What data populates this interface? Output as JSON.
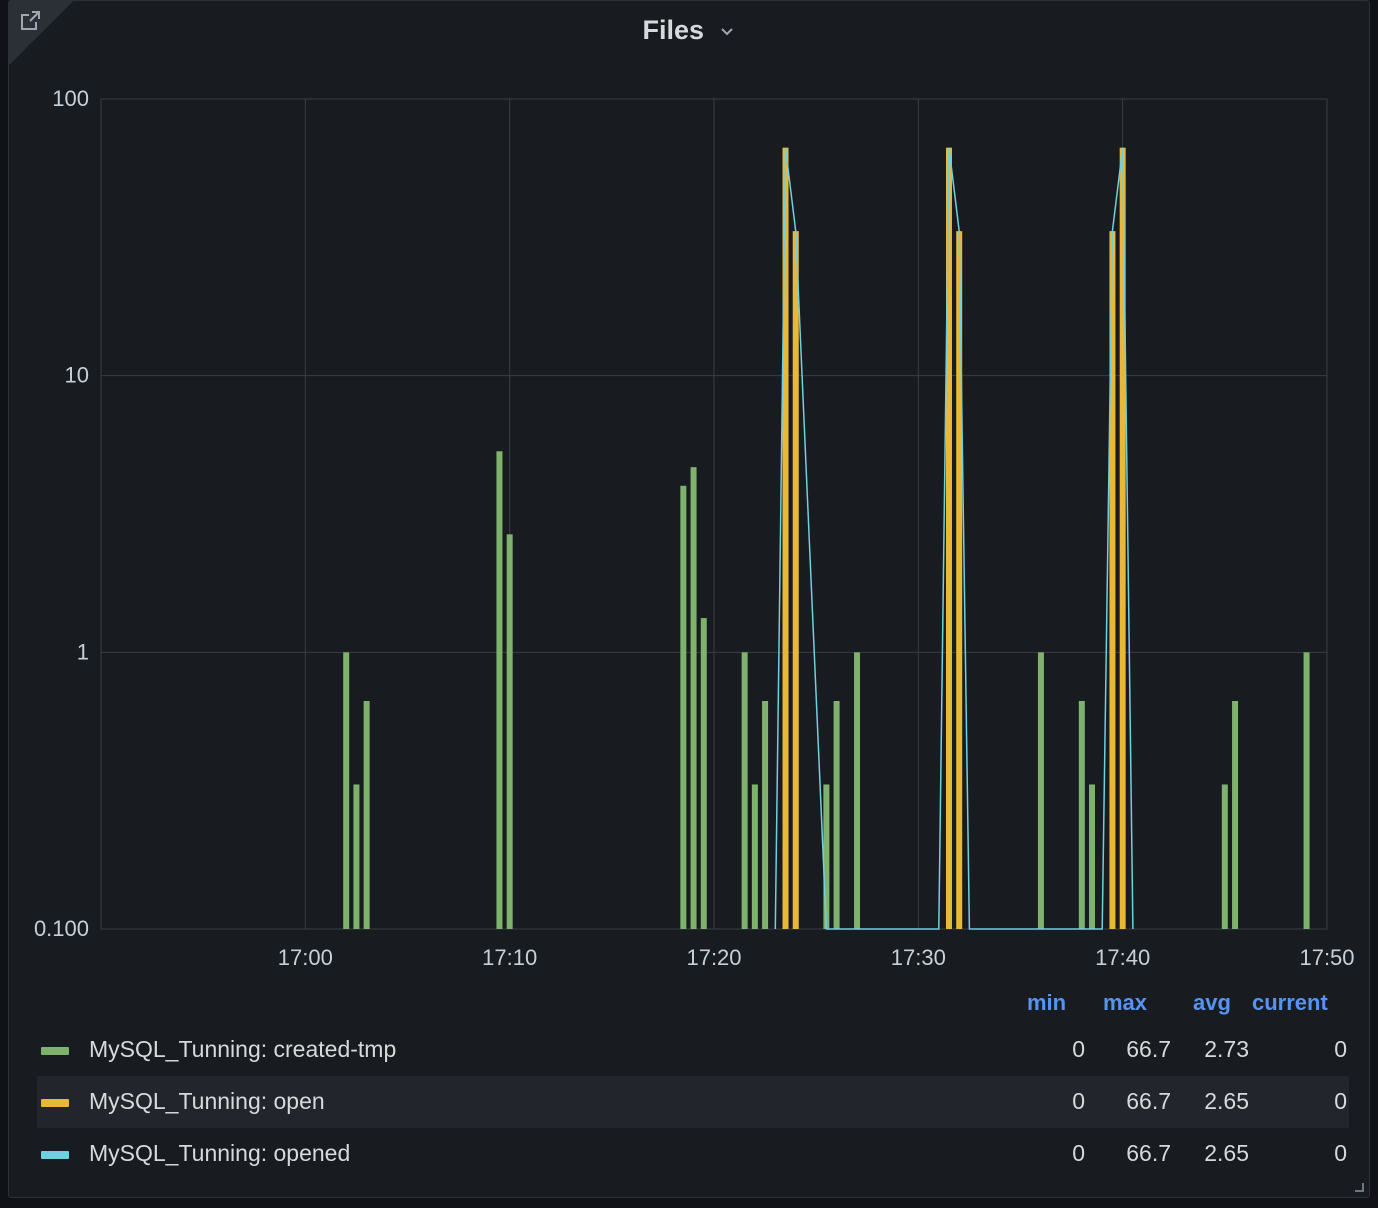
{
  "panel": {
    "title": "Files"
  },
  "icons": {
    "share": "external-link-icon",
    "title_menu": "chevron-down-icon",
    "resize": "resize-handle-icon"
  },
  "colors": {
    "background": "#181b1f",
    "grid": "#3a3d44",
    "created_tmp": "#7eb26d",
    "open": "#eab839",
    "opened": "#6ed0e0",
    "legend_header": "#5794f2"
  },
  "legend": {
    "headers": {
      "min": "min",
      "max": "max",
      "avg": "avg",
      "current": "current"
    },
    "rows": [
      {
        "name": "MySQL_Tunning: created-tmp",
        "min": "0",
        "max": "66.7",
        "avg": "2.73",
        "current": "0",
        "color": "#7eb26d"
      },
      {
        "name": "MySQL_Tunning: open",
        "min": "0",
        "max": "66.7",
        "avg": "2.65",
        "current": "0",
        "color": "#eab839"
      },
      {
        "name": "MySQL_Tunning: opened",
        "min": "0",
        "max": "66.7",
        "avg": "2.65",
        "current": "0",
        "color": "#6ed0e0"
      }
    ]
  },
  "chart_data": {
    "type": "bar",
    "title": "Files",
    "y_scale": "log10",
    "ylim": [
      0.1,
      100
    ],
    "y_ticks": [
      "0.100",
      "1",
      "10",
      "100"
    ],
    "x_range": [
      "16:50",
      "17:50"
    ],
    "x_ticks": [
      "17:00",
      "17:10",
      "17:20",
      "17:30",
      "17:40",
      "17:50"
    ],
    "grid": true,
    "legend_placement": "bottom",
    "series": [
      {
        "name": "MySQL_Tunning: created-tmp",
        "render": "bars",
        "color": "#7eb26d",
        "points": [
          {
            "t": "17:02",
            "v": 1
          },
          {
            "t": "17:02:30",
            "v": 0.333
          },
          {
            "t": "17:03",
            "v": 0.667
          },
          {
            "t": "17:09:30",
            "v": 5.33
          },
          {
            "t": "17:10",
            "v": 2.67
          },
          {
            "t": "17:18:30",
            "v": 4
          },
          {
            "t": "17:19",
            "v": 4.67
          },
          {
            "t": "17:19:30",
            "v": 1.33
          },
          {
            "t": "17:21:30",
            "v": 1
          },
          {
            "t": "17:22",
            "v": 0.333
          },
          {
            "t": "17:22:30",
            "v": 0.667
          },
          {
            "t": "17:25:30",
            "v": 0.333
          },
          {
            "t": "17:26",
            "v": 0.667
          },
          {
            "t": "17:27",
            "v": 1
          },
          {
            "t": "17:36",
            "v": 1
          },
          {
            "t": "17:38",
            "v": 0.667
          },
          {
            "t": "17:38:30",
            "v": 0.333
          },
          {
            "t": "17:45",
            "v": 0.333
          },
          {
            "t": "17:45:30",
            "v": 0.667
          },
          {
            "t": "17:49",
            "v": 1
          }
        ]
      },
      {
        "name": "MySQL_Tunning: open",
        "render": "bars",
        "color": "#eab839",
        "points": [
          {
            "t": "17:23:30",
            "v": 66.7
          },
          {
            "t": "17:24",
            "v": 33.3
          },
          {
            "t": "17:31:30",
            "v": 66.7
          },
          {
            "t": "17:32",
            "v": 33.3
          },
          {
            "t": "17:39:30",
            "v": 33.3
          },
          {
            "t": "17:40",
            "v": 66.7
          }
        ]
      },
      {
        "name": "MySQL_Tunning: opened",
        "render": "line",
        "color": "#6ed0e0",
        "points": [
          {
            "t": "17:23",
            "v": 0.1
          },
          {
            "t": "17:23:30",
            "v": 66.7
          },
          {
            "t": "17:24",
            "v": 33.3
          },
          {
            "t": "17:25:30",
            "v": 0.1
          },
          {
            "t": "17:31",
            "v": 0.1
          },
          {
            "t": "17:31:30",
            "v": 66.7
          },
          {
            "t": "17:32",
            "v": 33.3
          },
          {
            "t": "17:32:30",
            "v": 0.1
          },
          {
            "t": "17:39",
            "v": 0.1
          },
          {
            "t": "17:39:30",
            "v": 33.3
          },
          {
            "t": "17:40",
            "v": 66.7
          },
          {
            "t": "17:40:30",
            "v": 0.1
          }
        ]
      }
    ]
  }
}
